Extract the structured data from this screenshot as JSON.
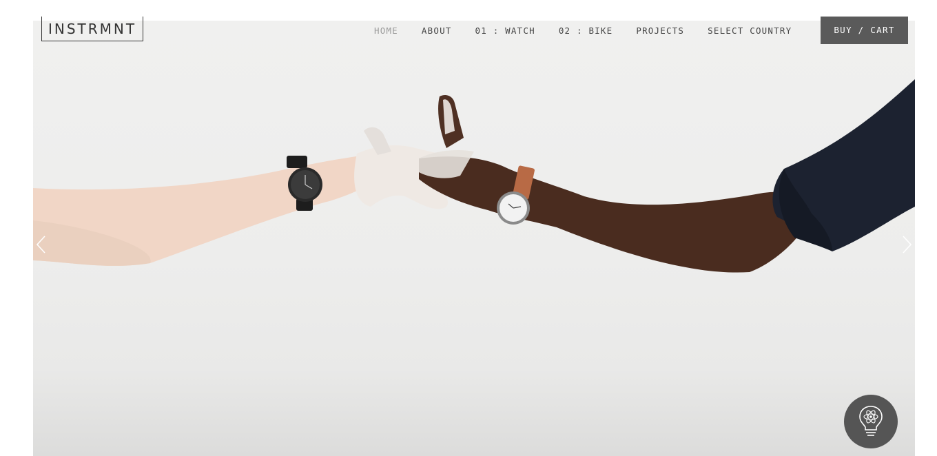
{
  "brand": {
    "logo_text": "INSTRMNT"
  },
  "nav": {
    "items": [
      {
        "label": "HOME",
        "active": true
      },
      {
        "label": "ABOUT",
        "active": false
      },
      {
        "label": "01 : WATCH",
        "active": false
      },
      {
        "label": "02 : BIKE",
        "active": false
      },
      {
        "label": "PROJECTS",
        "active": false
      },
      {
        "label": "SELECT COUNTRY",
        "active": false
      }
    ],
    "cart_label": "BUY / CART"
  },
  "carousel": {
    "prev_icon": "chevron-left-icon",
    "next_icon": "chevron-right-icon"
  },
  "help": {
    "icon": "atom-lightbulb-icon"
  },
  "colors": {
    "nav_active": "#9a9a9a",
    "nav_text": "#444444",
    "cart_bg": "#5a5a5a",
    "hero_bg": "#efefee",
    "help_bg": "#555555"
  }
}
